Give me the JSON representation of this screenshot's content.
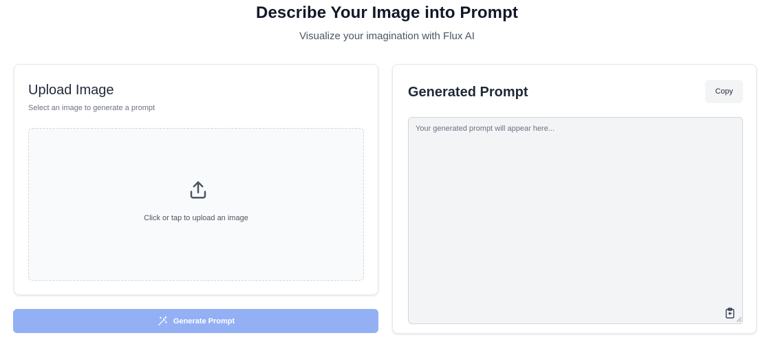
{
  "header": {
    "title": "Describe Your Image into Prompt",
    "subtitle": "Visualize your imagination with Flux AI"
  },
  "upload": {
    "title": "Upload Image",
    "description": "Select an image to generate a prompt",
    "dropzone_text": "Click or tap to upload an image",
    "icon": "upload-icon"
  },
  "generate": {
    "label": "Generate Prompt",
    "icon": "magic-wand-icon",
    "color": "#93b0f5"
  },
  "prompt": {
    "title": "Generated Prompt",
    "copy_label": "Copy",
    "value": "",
    "placeholder": "Your generated prompt will appear here...",
    "icon": "clipboard-icon"
  }
}
